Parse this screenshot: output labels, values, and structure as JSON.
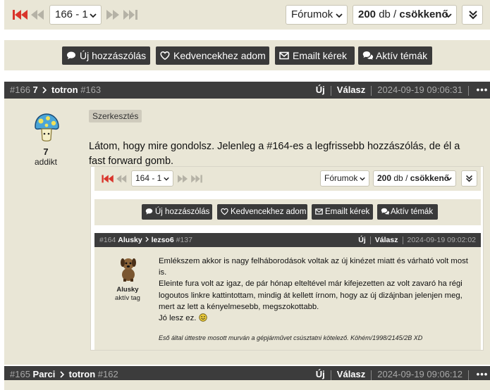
{
  "pager": {
    "page_select": "166 - 1",
    "forum_select": "Fórumok",
    "count_value": "200",
    "count_unit": "db",
    "order_value": "csökkenő"
  },
  "actions": [
    {
      "label": "Új hozzászólás",
      "icon": "comment-icon"
    },
    {
      "label": "Kedvencekhez adom",
      "icon": "heart-icon"
    },
    {
      "label": "Emailt kérek",
      "icon": "envelope-icon"
    },
    {
      "label": "Aktív témák",
      "icon": "comments-icon"
    }
  ],
  "post": {
    "num": "#166",
    "author_rank": "7",
    "target": "totron",
    "target_num": "#163",
    "new_label": "Új",
    "reply_label": "Válasz",
    "date": "2024-09-19 09:06:31",
    "menu": "•••",
    "user_level": "7",
    "user_title": "addikt",
    "tag": "Szerkesztés",
    "text": "Látom, hogy mire gondolsz. Jelenleg a #164-es a legfrissebb hozzászólás, de él a fast forward gomb."
  },
  "embedded": {
    "pager": {
      "page_select": "164 - 1",
      "forum_select": "Fórumok",
      "count_value": "200",
      "count_unit": "db",
      "order_value": "csökkenő"
    },
    "actions": [
      {
        "label": "Új hozzászólás"
      },
      {
        "label": "Kedvencekhez adom"
      },
      {
        "label": "Emailt kérek"
      },
      {
        "label": "Aktív témák"
      }
    ],
    "post": {
      "num": "#164",
      "author": "Alusky",
      "target": "lezso6",
      "target_num": "#137",
      "new_label": "Új",
      "reply_label": "Válasz",
      "date": "2024-09-19 09:02:02",
      "user_name": "Alusky",
      "user_title": "aktív tag",
      "lines": [
        "Emlékszem akkor is nagy felháborodások voltak az új kinézet miatt és várható volt most",
        "is.",
        "Eleinte fura volt az igaz, de pár hónap elteltével már kifejezetten az volt zavaró ha régi",
        "logoutos linkre kattintottam, mindig át kellett írnom, hogy az új dizájnban jelenjen meg,",
        "mert az lett a kényelmesebb, megszokottabb.",
        "Jó lesz ez."
      ],
      "signature": "Eső által úttestre mosott murván a gépjárművet csúsztatni kötelező. Köhém/1998/2145/2B XD"
    }
  },
  "post2": {
    "num": "#165",
    "author": "Parci",
    "target": "totron",
    "target_num": "#162",
    "new_label": "Új",
    "reply_label": "Válasz",
    "date": "2024-09-19 09:06:12",
    "menu": "•••"
  },
  "colors": {
    "accent_red": "#d9342b",
    "bar_bg": "#e9e6d6",
    "header_bg": "#3c3c3c"
  }
}
